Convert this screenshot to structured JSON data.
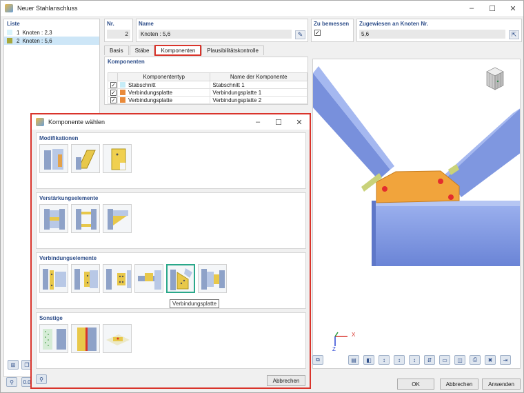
{
  "window": {
    "title": "Neuer Stahlanschluss",
    "controls": [
      "–",
      "☐",
      "✕"
    ]
  },
  "liste": {
    "header": "Liste",
    "items": [
      {
        "num": "1",
        "label": "Knoten : 2,3",
        "color": "#d9f3fb"
      },
      {
        "num": "2",
        "label": "Knoten : 5,6",
        "color": "#a7a83a"
      }
    ]
  },
  "fields": {
    "nr_label": "Nr.",
    "nr_value": "2",
    "name_label": "Name",
    "name_value": "Knoten : 5,6",
    "bemessen_label": "Zu bemessen",
    "bemessen_checked": "✓",
    "zugewiesen_label": "Zugewiesen an Knoten Nr.",
    "zugewiesen_value": "5,6"
  },
  "tabs": [
    "Basis",
    "Stäbe",
    "Komponenten",
    "Plausibilitätskontrolle"
  ],
  "komponenten": {
    "header": "Komponenten",
    "col_type": "Komponententyp",
    "col_name": "Name der Komponente",
    "rows": [
      {
        "checked": "✓",
        "color": "#c6ecf7",
        "type": "Stabschnitt",
        "name": "Stabschnitt 1"
      },
      {
        "checked": "✓",
        "color": "#e98a3a",
        "type": "Verbindungsplatte",
        "name": "Verbindungsplatte 1"
      },
      {
        "checked": "✓",
        "color": "#e98a3a",
        "type": "Verbindungsplatte",
        "name": "Verbindungsplatte 2"
      }
    ]
  },
  "axes": {
    "x": "X",
    "z": "Z"
  },
  "buttons": {
    "ok": "OK",
    "abbrechen": "Abbrechen",
    "anwenden": "Anwenden"
  },
  "dialog": {
    "title": "Komponente wählen",
    "sections": [
      {
        "label": "Modifikationen",
        "tiles": [
          "mod-1",
          "mod-2",
          "mod-3"
        ]
      },
      {
        "label": "Verstärkungselemente",
        "tiles": [
          "vs-1",
          "vs-2",
          "vs-3"
        ]
      },
      {
        "label": "Verbindungselemente",
        "tiles": [
          "vb-1",
          "vb-2",
          "vb-3",
          "vb-4",
          "vb-5",
          "vb-6"
        ]
      },
      {
        "label": "Sonstige",
        "tiles": [
          "so-1",
          "so-2",
          "so-3"
        ]
      }
    ],
    "tooltip": "Verbindungsplatte",
    "cancel": "Abbrechen"
  },
  "colors": {
    "accent": "#2f4f8a",
    "highlight": "#d9342b",
    "steel": "#7f97e0",
    "plate": "#f1a43c"
  }
}
